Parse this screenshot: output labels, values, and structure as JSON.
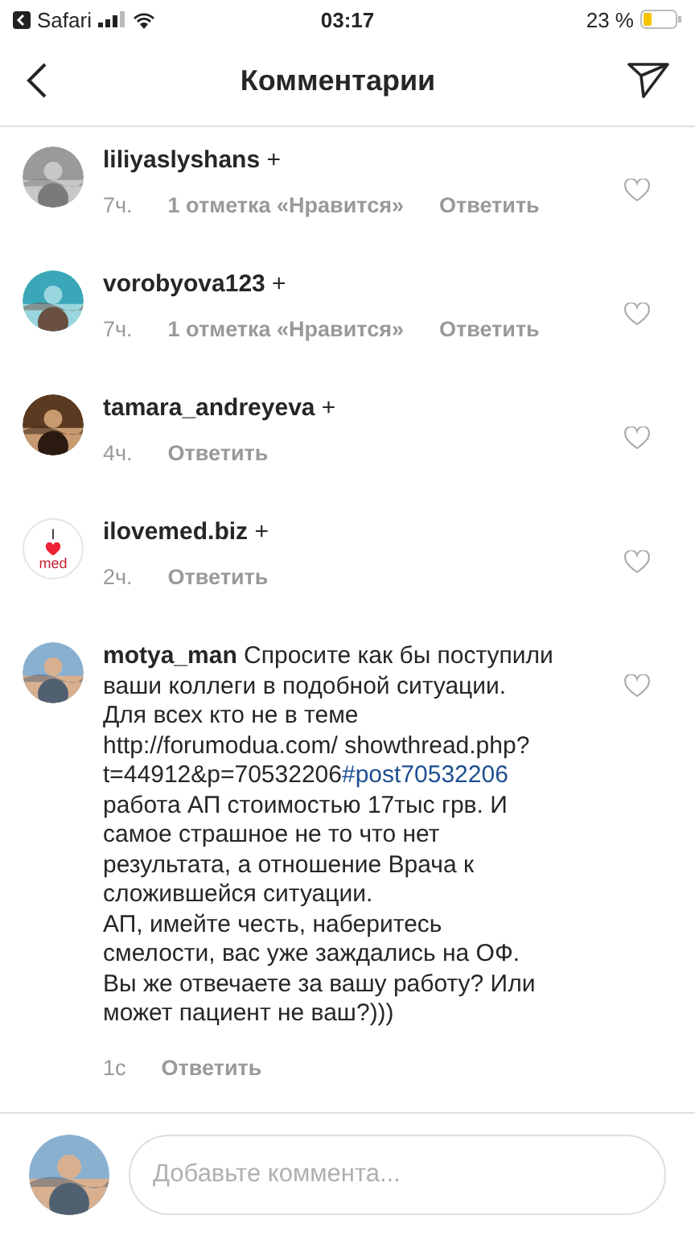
{
  "status_bar": {
    "back_app": "Safari",
    "time": "03:17",
    "battery": "23 %"
  },
  "header": {
    "title": "Комментарии"
  },
  "comments": [
    {
      "username": "liliyaslyshans",
      "follow": "+",
      "time": "7ч.",
      "likes": "1 отметка «Нравится»",
      "reply": "Ответить",
      "liked": false
    },
    {
      "username": "vorobyova123",
      "follow": "+",
      "time": "7ч.",
      "likes": "1 отметка «Нравится»",
      "reply": "Ответить",
      "liked": false
    },
    {
      "username": "tamara_andreyeva",
      "follow": "+",
      "time": "4ч.",
      "reply": "Ответить",
      "liked": false
    },
    {
      "username": "ilovemed.biz",
      "follow": "+",
      "avatar": {
        "kind": "logo",
        "logo_text": [
          "I",
          "med"
        ]
      },
      "time": "2ч.",
      "reply": "Ответить",
      "liked": false
    },
    {
      "username": "motya_man",
      "time": "1с",
      "reply": "Ответить",
      "liked": false,
      "body": [
        {
          "kind": "text",
          "text": "Спросите как бы поступили ваши коллеги в подобной ситуации.                          Для всех кто не в теме http://forumodua.com/ showthread.php? t=44912&p=70532206"
        },
        {
          "kind": "hashtag",
          "text": "#post70532206"
        },
        {
          "kind": "text",
          "text": " работа АП стоимостью 17тыс грв. И самое страшное не то что нет результата, а отношение Врача к сложившейся ситуации.\nАП, имейте честь, наберитесь смелости, вас уже заждались на ОФ. Вы же отвечаете за вашу работу? Или может пациент не ваш?)))"
        }
      ]
    }
  ],
  "composer": {
    "placeholder": "Добавьте коммента..."
  }
}
